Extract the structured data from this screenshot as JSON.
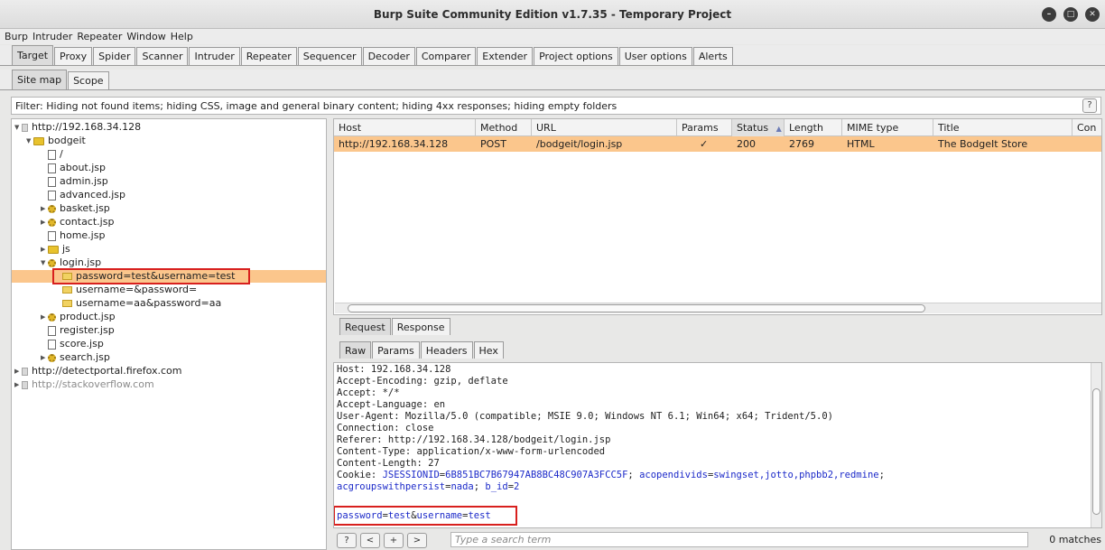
{
  "window": {
    "title": "Burp Suite Community Edition v1.7.35 - Temporary Project"
  },
  "menu": [
    "Burp",
    "Intruder",
    "Repeater",
    "Window",
    "Help"
  ],
  "main_tabs": [
    "Target",
    "Proxy",
    "Spider",
    "Scanner",
    "Intruder",
    "Repeater",
    "Sequencer",
    "Decoder",
    "Comparer",
    "Extender",
    "Project options",
    "User options",
    "Alerts"
  ],
  "sub_tabs": [
    "Site map",
    "Scope"
  ],
  "filter": {
    "text": "Filter: Hiding not found items;  hiding CSS, image and general binary content;  hiding 4xx responses;  hiding empty folders",
    "help": "?"
  },
  "tree": [
    {
      "label": "http://192.168.34.128",
      "icon": "host-icon"
    },
    {
      "label": "bodgeit",
      "icon": "folder-icon"
    },
    {
      "label": "/",
      "icon": "file-icon"
    },
    {
      "label": "about.jsp",
      "icon": "file-icon"
    },
    {
      "label": "admin.jsp",
      "icon": "file-icon"
    },
    {
      "label": "advanced.jsp",
      "icon": "file-icon"
    },
    {
      "label": "basket.jsp",
      "icon": "gear-icon"
    },
    {
      "label": "contact.jsp",
      "icon": "gear-icon"
    },
    {
      "label": "home.jsp",
      "icon": "file-icon"
    },
    {
      "label": "js",
      "icon": "folder-icon"
    },
    {
      "label": "login.jsp",
      "icon": "gear-icon"
    },
    {
      "label": "password=test&username=test",
      "icon": "envelope-icon"
    },
    {
      "label": "username=&password=",
      "icon": "envelope-icon"
    },
    {
      "label": "username=aa&password=aa",
      "icon": "envelope-icon"
    },
    {
      "label": "product.jsp",
      "icon": "gear-icon"
    },
    {
      "label": "register.jsp",
      "icon": "file-icon"
    },
    {
      "label": "score.jsp",
      "icon": "file-icon"
    },
    {
      "label": "search.jsp",
      "icon": "gear-icon"
    },
    {
      "label": "http://detectportal.firefox.com",
      "icon": "host-icon"
    },
    {
      "label": "http://stackoverflow.com",
      "icon": "host-icon"
    }
  ],
  "table": {
    "columns": [
      "Host",
      "Method",
      "URL",
      "Params",
      "Status",
      "Length",
      "MIME type",
      "Title",
      "Con"
    ],
    "sort_indicator": "▲",
    "row": [
      "http://192.168.34.128",
      "POST",
      "/bodgeit/login.jsp",
      "✓",
      "200",
      "2769",
      "HTML",
      "The BodgeIt Store",
      ""
    ]
  },
  "req_tabs": [
    "Request",
    "Response"
  ],
  "view_tabs": [
    "Raw",
    "Params",
    "Headers",
    "Hex"
  ],
  "raw": {
    "lines": [
      "Host: 192.168.34.128",
      "Accept-Encoding: gzip, deflate",
      "Accept: */*",
      "Accept-Language: en",
      "User-Agent: Mozilla/5.0 (compatible; MSIE 9.0; Windows NT 6.1; Win64; x64; Trident/5.0)",
      "Connection: close",
      "Referer: http://192.168.34.128/bodgeit/login.jsp",
      "Content-Type: application/x-www-form-urlencoded",
      "Content-Length: 27"
    ],
    "cookie_prefix": "Cookie: ",
    "cookie": {
      "k1": "JSESSIONID",
      "v1": "6B851BC7B67947AB8BC48C907A3FCC5F",
      "k2": "acopendivids",
      "v2": "swingset,jotto,phpbb2,redmine",
      "k3": "acgroupswithpersist",
      "v3": "nada",
      "k4": "b_id",
      "v4": "2"
    },
    "body": {
      "k1": "password",
      "v1": "test",
      "k2": "username",
      "v2": "test"
    }
  },
  "search": {
    "help": "?",
    "prev": "<",
    "add": "+",
    "next": ">",
    "placeholder": "Type a search term",
    "matches": "0 matches"
  }
}
